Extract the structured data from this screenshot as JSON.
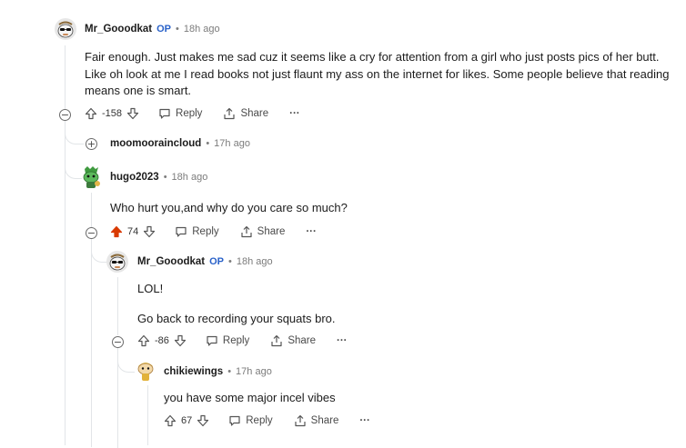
{
  "comments": [
    {
      "author": "Mr_Gooodkat",
      "op_badge": "OP",
      "separator": "•",
      "time": "18h ago",
      "body": [
        "Fair enough. Just makes me sad cuz it seems like a cry for attention from a girl who just posts pics of her butt. Like oh look at me I read books not just flaunt my ass on the internet for likes. Some people believe that reading means one is smart."
      ],
      "score": "-158"
    },
    {
      "author": "moomooraincloud",
      "separator": "•",
      "time": "17h ago"
    },
    {
      "author": "hugo2023",
      "separator": "•",
      "time": "18h ago",
      "body": [
        "Who hurt you,and why do you care so much?"
      ],
      "score": "74"
    },
    {
      "author": "Mr_Gooodkat",
      "op_badge": "OP",
      "separator": "•",
      "time": "18h ago",
      "body": [
        "LOL!",
        "Go back to recording your squats bro."
      ],
      "score": "-86"
    },
    {
      "author": "chikiewings",
      "separator": "•",
      "time": "17h ago",
      "body": [
        "you have some major incel vibes"
      ],
      "score": "67"
    }
  ],
  "actions": {
    "reply": "Reply",
    "share": "Share",
    "more": "···"
  },
  "icons": {
    "upvote": "arrow-up-icon",
    "downvote": "arrow-down-icon",
    "reply": "speech-bubble-icon",
    "share": "share-icon",
    "collapse": "minus-circle-icon",
    "expand": "plus-circle-icon"
  },
  "colors": {
    "upvoted": "#d93a00",
    "op_badge": "#2a62c9",
    "meta": "#7c7c7c"
  }
}
